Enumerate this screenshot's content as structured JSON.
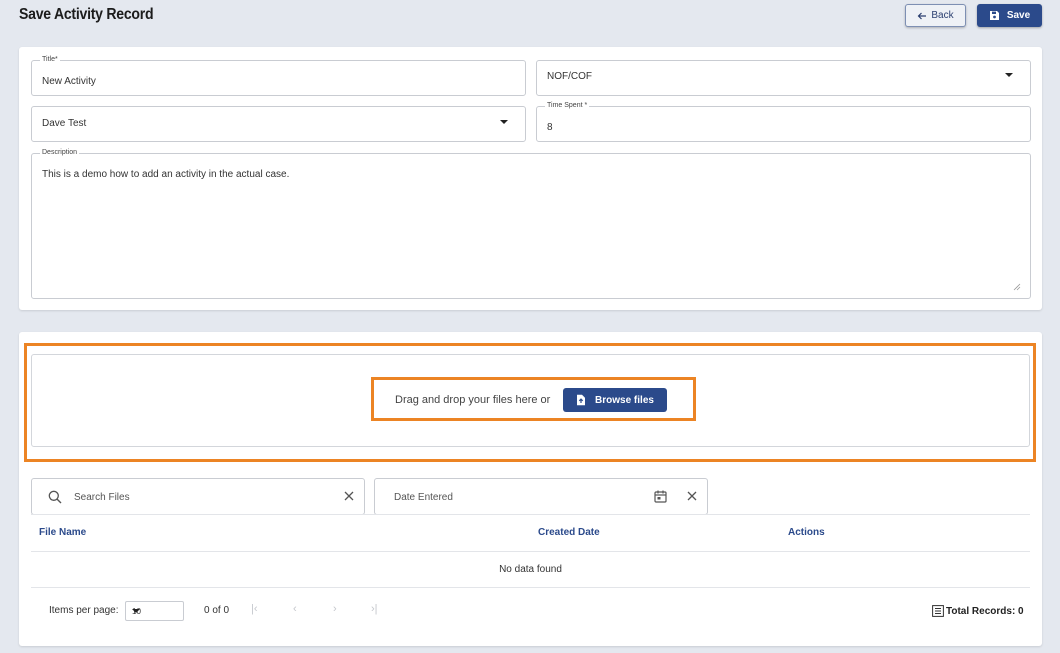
{
  "header": {
    "title": "Save Activity Record",
    "back_label": "Back",
    "save_label": "Save"
  },
  "form": {
    "title_label": "Title*",
    "title_value": "New Activity",
    "type_value": "NOF/COF",
    "user_value": "Dave Test",
    "time_label": "Time Spent *",
    "time_value": "8",
    "description_label": "Description",
    "description_value": "This is a demo how to add an activity in the actual case."
  },
  "upload": {
    "drag_text": "Drag and drop your files here or",
    "browse_label": "Browse files"
  },
  "filters": {
    "search_placeholder": "Search Files",
    "date_placeholder": "Date Entered"
  },
  "table": {
    "columns": [
      "File Name",
      "Created Date",
      "Actions"
    ],
    "empty_text": "No data found"
  },
  "pagination": {
    "items_per_page_label": "Items per page:",
    "page_size": "10",
    "range": "0 of 0",
    "total_records": "Total Records: 0"
  },
  "colors": {
    "primary": "#2b4a8b",
    "highlight": "#ec8424",
    "background": "#e4e8ef"
  }
}
